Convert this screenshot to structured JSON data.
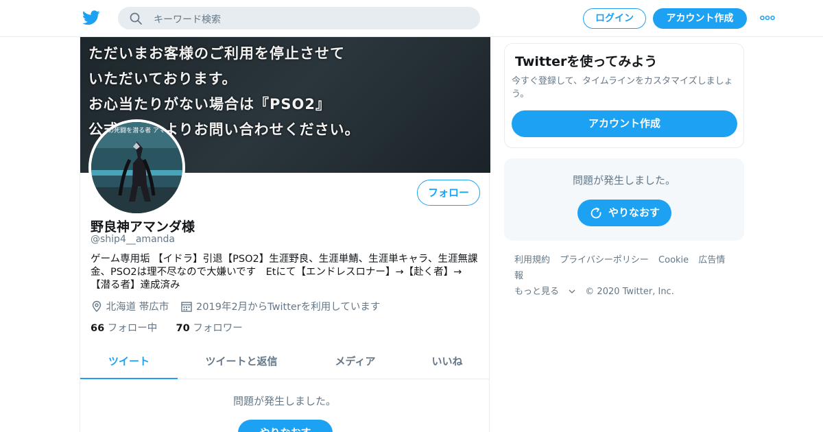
{
  "header": {
    "search_placeholder": "キーワード検索",
    "login_label": "ログイン",
    "signup_label": "アカウント作成"
  },
  "profile": {
    "banner_lines": [
      "ただいまお客様のご利用を停止させて",
      "いただいております。",
      "お心当たりがない場合は『PSO2』",
      "公式サイトよりお問い合わせください。"
    ],
    "avatar_caption": "追憶の死闘を潜る者 アマンダ",
    "follow_label": "フォロー",
    "name": "野良神アマンダ様",
    "handle": "@ship4__amanda",
    "bio": "ゲーム専用垢 【イドラ】引退【PSO2】生涯野良、生涯単鯖、生涯単キャラ、生涯無課金、PSO2は理不尽なので大嫌いです　Etにて【エンドレスロナー】→【赴く者】→【潜る者】達成済み",
    "location": "北海道 帯広市",
    "joined": "2019年2月からTwitterを利用しています",
    "following_count": "66",
    "following_label": "フォロー中",
    "followers_count": "70",
    "followers_label": "フォロワー"
  },
  "tabs": [
    "ツイート",
    "ツイートと返信",
    "メディア",
    "いいね"
  ],
  "feed": {
    "error_text": "問題が発生しました。",
    "retry_label": "やりなおす"
  },
  "sidebar": {
    "signup_card": {
      "title": "Twitterを使ってみよう",
      "description": "今すぐ登録して、タイムラインをカスタマイズしましょう。",
      "button_label": "アカウント作成"
    },
    "error_card": {
      "text": "問題が発生しました。",
      "retry_label": "やりなおす"
    },
    "footer_links": [
      "利用規約",
      "プライバシーポリシー",
      "Cookie",
      "広告情報",
      "もっと見る"
    ],
    "copyright": "© 2020 Twitter, Inc."
  },
  "colors": {
    "accent": "#1da1f2",
    "secondary_text": "#657786",
    "border": "#e6ecf0"
  }
}
